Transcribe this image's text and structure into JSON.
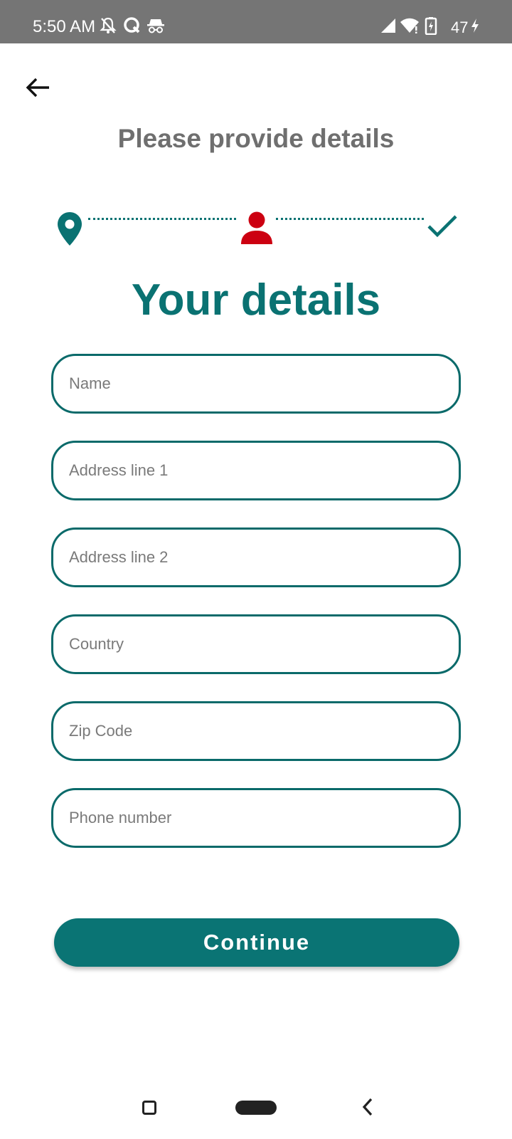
{
  "status_bar": {
    "time": "5:50 AM",
    "battery": "47",
    "icons": [
      "mute-icon",
      "q-app-icon",
      "incognito-icon",
      "signal-icon",
      "wifi-icon",
      "battery-icon",
      "charging-icon"
    ]
  },
  "header": {
    "back_icon": "arrow-left-icon",
    "title": "Please provide details"
  },
  "stepper": {
    "steps": [
      {
        "icon": "location-pin-icon",
        "state": "done",
        "color": "#0a7272"
      },
      {
        "icon": "person-icon",
        "state": "current",
        "color": "#cc0011"
      },
      {
        "icon": "checkmark-icon",
        "state": "pending",
        "color": "#0a7272"
      }
    ]
  },
  "section_title": "Your details",
  "form": {
    "fields": [
      {
        "placeholder": "Name",
        "value": ""
      },
      {
        "placeholder": "Address line 1",
        "value": ""
      },
      {
        "placeholder": "Address line 2",
        "value": ""
      },
      {
        "placeholder": "Country",
        "value": ""
      },
      {
        "placeholder": "Zip Code",
        "value": ""
      },
      {
        "placeholder": "Phone number",
        "value": ""
      }
    ]
  },
  "continue_label": "Continue",
  "colors": {
    "accent": "#0a7272",
    "active_step": "#cc0011",
    "status_bar": "#757575",
    "title_gray": "#6f6f6f"
  },
  "nav_bar": {
    "icons": [
      "recent-apps-icon",
      "home-pill-icon",
      "back-chevron-icon"
    ]
  }
}
